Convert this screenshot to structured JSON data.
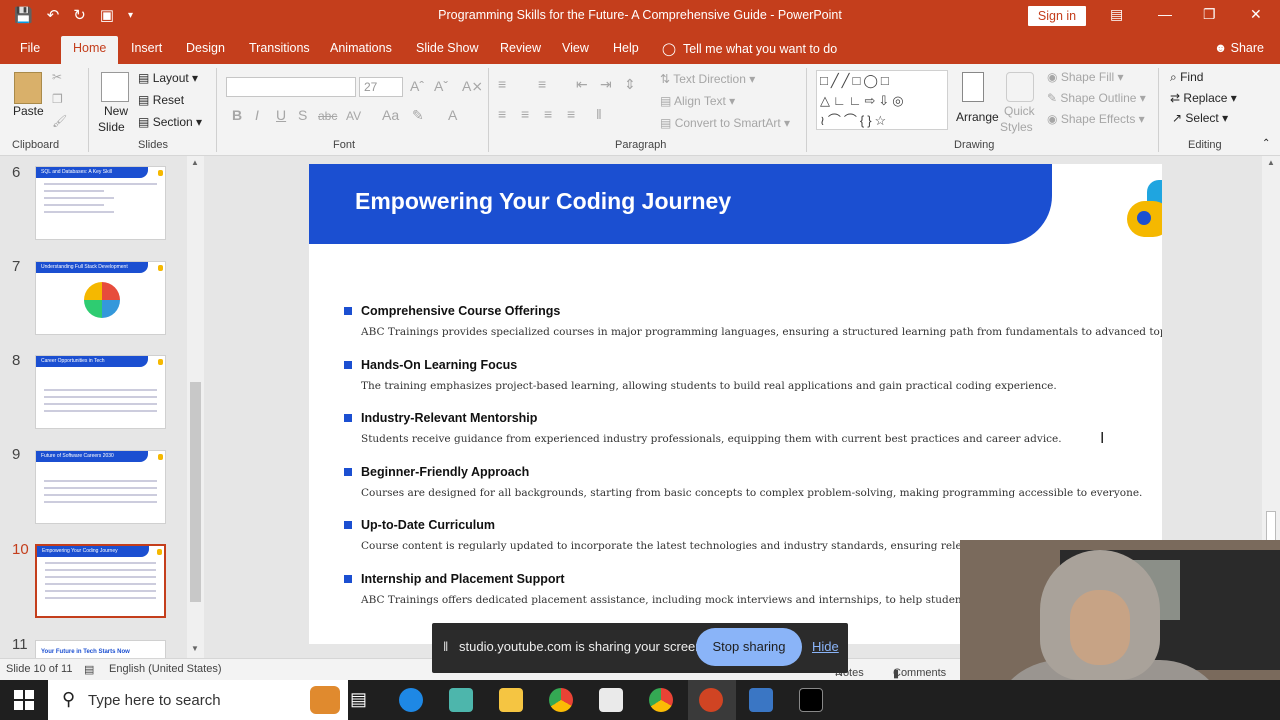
{
  "window": {
    "title": "Programming Skills for the Future- A Comprehensive Guide  -  PowerPoint",
    "sign_in": "Sign in"
  },
  "tabs": [
    "File",
    "Home",
    "Insert",
    "Design",
    "Transitions",
    "Animations",
    "Slide Show",
    "Review",
    "View",
    "Help"
  ],
  "tell_me": "Tell me what you want to do",
  "share": "Share",
  "ribbon": {
    "clipboard": {
      "paste": "Paste",
      "label": "Clipboard"
    },
    "slides": {
      "new_slide_1": "New",
      "new_slide_2": "Slide",
      "layout": "Layout",
      "reset": "Reset",
      "section": "Section",
      "label": "Slides"
    },
    "font": {
      "size": "27",
      "label": "Font"
    },
    "paragraph": {
      "text_direction": "Text Direction",
      "align_text": "Align Text",
      "convert": "Convert to SmartArt",
      "label": "Paragraph"
    },
    "drawing": {
      "arrange": "Arrange",
      "quick_1": "Quick",
      "quick_2": "Styles",
      "shape_fill": "Shape Fill",
      "shape_outline": "Shape Outline",
      "shape_effects": "Shape Effects",
      "label": "Drawing"
    },
    "editing": {
      "find": "Find",
      "replace": "Replace",
      "select": "Select",
      "label": "Editing"
    }
  },
  "thumbnails": [
    {
      "num": "6",
      "title": "SQL and Databases: A Key Skill"
    },
    {
      "num": "7",
      "title": "Understanding Full Stack Development"
    },
    {
      "num": "8",
      "title": "Career Opportunities in Tech"
    },
    {
      "num": "9",
      "title": "Future of Software Careers 2030"
    },
    {
      "num": "10",
      "title": "Empowering Your Coding Journey"
    },
    {
      "num": "11",
      "title": "Your Future in Tech Starts Now"
    }
  ],
  "slide": {
    "title": "Empowering Your Coding Journey",
    "bullets": [
      {
        "head": "Comprehensive Course Offerings",
        "desc": "ABC Trainings provides specialized courses in major programming languages, ensuring a structured learning path from fundamentals to advanced topics."
      },
      {
        "head": "Hands-On Learning Focus",
        "desc": "The training emphasizes project-based learning, allowing students to build real applications and gain practical coding experience."
      },
      {
        "head": "Industry-Relevant Mentorship",
        "desc": "Students receive guidance from experienced industry professionals, equipping them with current best practices and career advice."
      },
      {
        "head": "Beginner-Friendly Approach",
        "desc": "Courses are designed for all backgrounds, starting from basic concepts to complex problem-solving, making programming accessible to everyone."
      },
      {
        "head": "Up-to-Date Curriculum",
        "desc": "Course content is regularly updated to incorporate the latest technologies and industry standards, ensuring relevance in"
      },
      {
        "head": "Internship and Placement Support",
        "desc": "ABC Trainings offers dedicated placement assistance, including mock interviews and internships, to help students secure"
      }
    ]
  },
  "status": {
    "slide": "Slide 10 of 11",
    "language": "English (United States)",
    "notes": "Notes",
    "comments": "Comments"
  },
  "share_banner": {
    "message": "studio.youtube.com is sharing your screen.",
    "stop": "Stop sharing",
    "hide": "Hide"
  },
  "taskbar": {
    "search_placeholder": "Type here to search"
  },
  "colors": {
    "accent": "#c43e1c",
    "slide_blue": "#1b4fd1",
    "slide_yellow": "#f5b800"
  }
}
